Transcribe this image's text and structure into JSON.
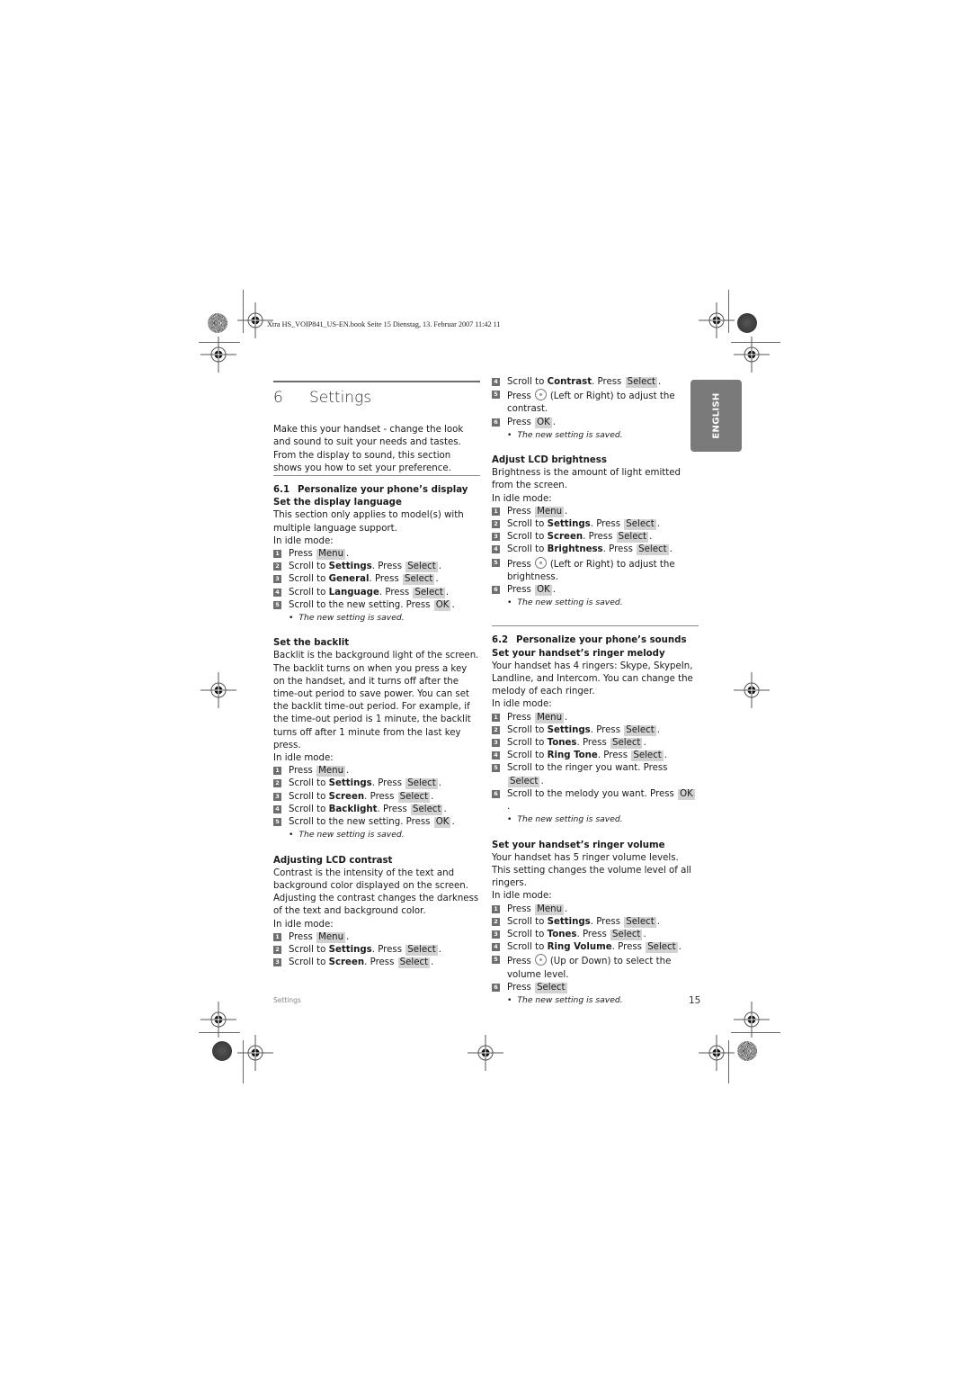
{
  "header": {
    "book_line": "Xtra HS_VOIP841_US-EN.book  Seite 15  Dienstag, 13. Februar 2007  11:42 11"
  },
  "chapter": {
    "number": "6",
    "title": "Settings",
    "intro": "Make this your handset - change the look and sound to suit your needs and tastes. From the display to sound, this section shows you how to set your preference."
  },
  "section_6_1": {
    "number": "6.1",
    "title": "Personalize your phone’s display",
    "display_language": {
      "heading": "Set the display language",
      "body": "This section only applies to model(s) with multiple language support.",
      "idle": "In idle mode:",
      "steps": [
        {
          "n": "1",
          "pre": "Press ",
          "bold": "",
          "mid": "",
          "key": "Menu",
          "post": "."
        },
        {
          "n": "2",
          "pre": "Scroll to ",
          "bold": "Settings",
          "mid": ". Press ",
          "key": "Select",
          "post": "."
        },
        {
          "n": "3",
          "pre": "Scroll to ",
          "bold": "General",
          "mid": ". Press ",
          "key": "Select",
          "post": "."
        },
        {
          "n": "4",
          "pre": "Scroll to ",
          "bold": "Language",
          "mid": ". Press ",
          "key": "Select",
          "post": "."
        },
        {
          "n": "5",
          "pre": "Scroll to the new setting. Press ",
          "bold": "",
          "mid": "",
          "key": "OK",
          "post": "."
        }
      ],
      "note": "The new setting is saved."
    },
    "backlit": {
      "heading": "Set the backlit",
      "body": "Backlit is the background light of the screen. The backlit turns on when you press a key on the handset, and it turns off after the time-out period to save power. You can set the backlit time-out period. For example, if the time-out period is 1 minute, the backlit turns off after 1 minute from the last key press.",
      "idle": "In idle mode:",
      "steps": [
        {
          "n": "1",
          "pre": "Press ",
          "bold": "",
          "mid": "",
          "key": "Menu",
          "post": "."
        },
        {
          "n": "2",
          "pre": "Scroll to ",
          "bold": "Settings",
          "mid": ". Press ",
          "key": "Select",
          "post": "."
        },
        {
          "n": "3",
          "pre": "Scroll to ",
          "bold": "Screen",
          "mid": ". Press ",
          "key": "Select",
          "post": "."
        },
        {
          "n": "4",
          "pre": "Scroll to ",
          "bold": "Backlight",
          "mid": ". Press ",
          "key": "Select",
          "post": "."
        },
        {
          "n": "5",
          "pre": "Scroll to the new setting. Press ",
          "bold": "",
          "mid": "",
          "key": "OK",
          "post": "."
        }
      ],
      "note": "The new setting is saved."
    },
    "contrast": {
      "heading": "Adjusting LCD contrast",
      "body": "Contrast is the intensity of the text and background color displayed on the screen. Adjusting the contrast changes the darkness of the text and background color.",
      "idle": "In idle mode:",
      "steps_left": [
        {
          "n": "1",
          "pre": "Press ",
          "bold": "",
          "mid": "",
          "key": "Menu",
          "post": "."
        },
        {
          "n": "2",
          "pre": "Scroll to ",
          "bold": "Settings",
          "mid": ". Press ",
          "key": "Select",
          "post": "."
        },
        {
          "n": "3",
          "pre": "Scroll to ",
          "bold": "Screen",
          "mid": ". Press ",
          "key": "Select",
          "post": "."
        }
      ],
      "step4": {
        "n": "4",
        "pre": "Scroll to ",
        "bold": "Contrast",
        "mid": ". Press ",
        "key": "Select",
        "post": "."
      },
      "step5": {
        "n": "5",
        "pre": "Press",
        "post": "(Left or Right) to adjust the contrast."
      },
      "step6": {
        "n": "6",
        "pre": "Press ",
        "key": "OK",
        "post": "."
      },
      "note": "The new setting is saved."
    },
    "brightness": {
      "heading": "Adjust LCD brightness",
      "body": "Brightness is the amount of light emitted from the screen.",
      "idle": "In idle mode:",
      "steps": [
        {
          "n": "1",
          "pre": "Press ",
          "bold": "",
          "mid": "",
          "key": "Menu",
          "post": "."
        },
        {
          "n": "2",
          "pre": "Scroll to ",
          "bold": "Settings",
          "mid": ". Press ",
          "key": "Select",
          "post": "."
        },
        {
          "n": "3",
          "pre": "Scroll to ",
          "bold": "Screen",
          "mid": ". Press ",
          "key": "Select",
          "post": "."
        },
        {
          "n": "4",
          "pre": "Scroll to ",
          "bold": "Brightness",
          "mid": ". Press ",
          "key": "Select",
          "post": "."
        }
      ],
      "step5": {
        "n": "5",
        "pre": "Press",
        "post": "(Left or Right) to adjust the brightness."
      },
      "step6": {
        "n": "6",
        "pre": "Press ",
        "key": "OK",
        "post": "."
      },
      "note": "The new setting is saved."
    }
  },
  "section_6_2": {
    "number": "6.2",
    "title": "Personalize your phone’s sounds",
    "melody": {
      "heading": "Set your handset’s ringer melody",
      "body": "Your handset has 4 ringers: Skype, SkypeIn, Landline, and Intercom. You can change the melody of each ringer.",
      "idle": "In idle mode:",
      "steps": [
        {
          "n": "1",
          "pre": "Press ",
          "bold": "",
          "mid": "",
          "key": "Menu",
          "post": "."
        },
        {
          "n": "2",
          "pre": "Scroll to ",
          "bold": "Settings",
          "mid": ". Press ",
          "key": "Select",
          "post": "."
        },
        {
          "n": "3",
          "pre": "Scroll to ",
          "bold": "Tones",
          "mid": ". Press ",
          "key": "Select",
          "post": "."
        },
        {
          "n": "4",
          "pre": "Scroll to ",
          "bold": "Ring Tone",
          "mid": ". Press ",
          "key": "Select",
          "post": "."
        },
        {
          "n": "5",
          "pre": "Scroll to the ringer you want. Press ",
          "bold": "",
          "mid": "",
          "key": "Select",
          "post": "."
        },
        {
          "n": "6",
          "pre": "Scroll to the melody you want. Press ",
          "bold": "",
          "mid": "",
          "key": "OK",
          "post": "."
        }
      ],
      "note": "The new setting is saved."
    },
    "volume": {
      "heading": "Set your handset’s ringer volume",
      "body": "Your handset has 5 ringer volume levels. This setting changes the volume level of all ringers.",
      "idle": "In idle mode:",
      "steps": [
        {
          "n": "1",
          "pre": "Press ",
          "bold": "",
          "mid": "",
          "key": "Menu",
          "post": "."
        },
        {
          "n": "2",
          "pre": "Scroll to ",
          "bold": "Settings",
          "mid": ". Press ",
          "key": "Select",
          "post": "."
        },
        {
          "n": "3",
          "pre": "Scroll to ",
          "bold": "Tones",
          "mid": ". Press ",
          "key": "Select",
          "post": "."
        },
        {
          "n": "4",
          "pre": "Scroll to ",
          "bold": "Ring Volume",
          "mid": ". Press ",
          "key": "Select",
          "post": "."
        }
      ],
      "step5": {
        "n": "5",
        "pre": "Press",
        "post": "(Up or Down) to select the volume level."
      },
      "step6": {
        "n": "6",
        "pre": "Press ",
        "key": "Select",
        "post": ""
      },
      "note": "The new setting is saved."
    }
  },
  "side_tab": {
    "label": "ENGLISH"
  },
  "footer": {
    "section": "Settings",
    "page": "15"
  },
  "icons": {
    "nav_key": "navigation-key-icon",
    "step_badge": "step-number-badge"
  }
}
